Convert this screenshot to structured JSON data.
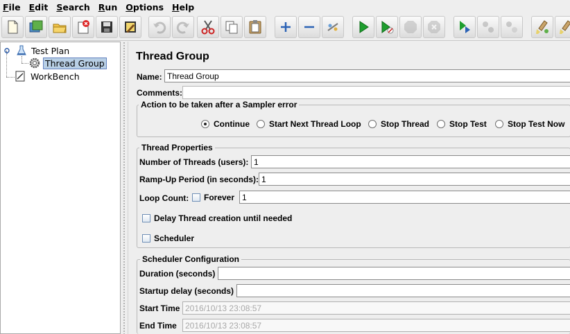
{
  "menu": {
    "items": [
      {
        "mnemonic": "F",
        "rest": "ile"
      },
      {
        "mnemonic": "E",
        "rest": "dit"
      },
      {
        "mnemonic": "S",
        "rest": "earch"
      },
      {
        "mnemonic": "R",
        "rest": "un"
      },
      {
        "mnemonic": "O",
        "rest": "ptions"
      },
      {
        "mnemonic": "H",
        "rest": "elp"
      }
    ]
  },
  "toolbar": {
    "buttons": [
      "new-icon",
      "templates-icon",
      "open-icon",
      "close-icon",
      "save-icon",
      "save-as-icon",
      "undo-icon",
      "redo-icon",
      "cut-icon",
      "copy-icon",
      "paste-icon",
      "expand-icon",
      "collapse-icon",
      "toggle-icon",
      "start-icon",
      "start-no-pause-icon",
      "stop-icon",
      "shutdown-icon",
      "remote-start-icon",
      "remote-stop-icon",
      "remote-shutdown-icon",
      "clear-icon",
      "clear-all-icon"
    ]
  },
  "tree": {
    "test_plan": "Test Plan",
    "thread_group": "Thread Group",
    "workbench": "WorkBench"
  },
  "panel": {
    "title": "Thread Group",
    "name_label": "Name:",
    "name_value": "Thread Group",
    "comments_label": "Comments:",
    "comments_value": ""
  },
  "sampler_error": {
    "title": "Action to be taken after a Sampler error",
    "options": [
      "Continue",
      "Start Next Thread Loop",
      "Stop Thread",
      "Stop Test",
      "Stop Test Now"
    ],
    "selected": "Continue"
  },
  "thread_properties": {
    "title": "Thread Properties",
    "num_threads_label": "Number of Threads (users):",
    "num_threads_value": "1",
    "ramp_up_label": "Ramp-Up Period (in seconds):",
    "ramp_up_value": "1",
    "loop_count_label": "Loop Count:",
    "forever_label": "Forever",
    "loop_count_value": "1",
    "delay_label": "Delay Thread creation until needed",
    "scheduler_label": "Scheduler"
  },
  "scheduler_config": {
    "title": "Scheduler Configuration",
    "duration_label": "Duration (seconds)",
    "duration_value": "",
    "startup_delay_label": "Startup delay (seconds)",
    "startup_delay_value": "",
    "start_time_label": "Start Time",
    "start_time_value": "2016/10/13 23:08:57",
    "end_time_label": "End Time",
    "end_time_value": "2016/10/13 23:08:57"
  },
  "colors": {
    "selection": "#b8cfe5",
    "selection_border": "#6382bf",
    "background": "#eeeeee"
  }
}
